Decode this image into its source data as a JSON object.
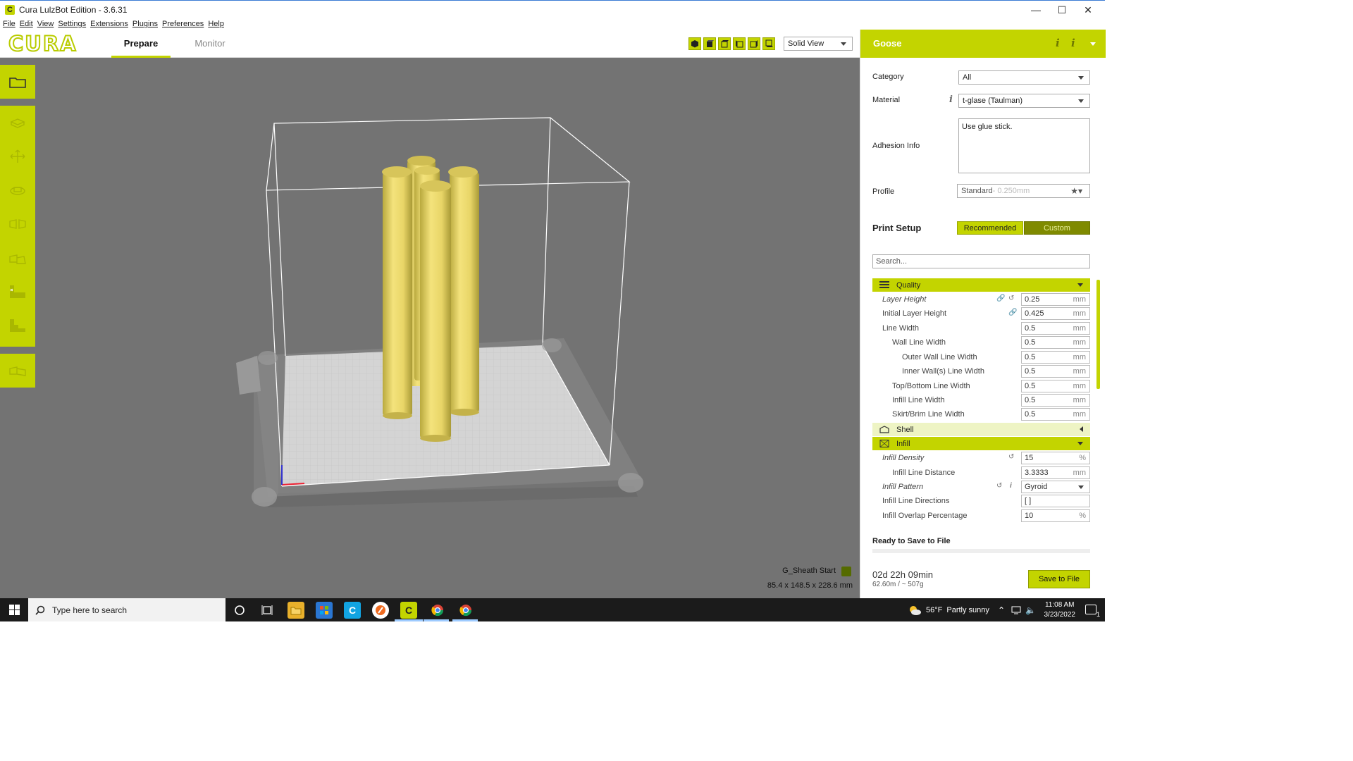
{
  "window": {
    "title": "Cura LulzBot Edition - 3.6.31"
  },
  "menu": [
    "File",
    "Edit",
    "View",
    "Settings",
    "Extensions",
    "Plugins",
    "Preferences",
    "Help"
  ],
  "header": {
    "logo": "CURA",
    "tabs": [
      {
        "label": "Prepare",
        "active": true
      },
      {
        "label": "Monitor",
        "active": false
      }
    ],
    "view_mode": "Solid View"
  },
  "viewport": {
    "object_name": "G_Sheath Start",
    "object_dims": "85.4 x 148.5 x 228.6 mm"
  },
  "panel": {
    "printer_name": "Goose",
    "category_label": "Category",
    "category_value": "All",
    "material_label": "Material",
    "material_value": "t-glase (Taulman)",
    "adhesion_label": "Adhesion Info",
    "adhesion_value": "Use glue stick.",
    "profile_label": "Profile",
    "profile_name": "Standard",
    "profile_detail": " - 0.250mm",
    "print_setup": "Print Setup",
    "mode_recommended": "Recommended",
    "mode_custom": "Custom",
    "search_placeholder": "Search...",
    "categories": {
      "quality": "Quality",
      "shell": "Shell",
      "infill": "Infill"
    },
    "quality_settings": [
      {
        "name": "Layer Height",
        "value": "0.25",
        "unit": "mm"
      },
      {
        "name": "Initial Layer Height",
        "value": "0.425",
        "unit": "mm"
      },
      {
        "name": "Line Width",
        "value": "0.5",
        "unit": "mm"
      },
      {
        "name": "Wall Line Width",
        "value": "0.5",
        "unit": "mm"
      },
      {
        "name": "Outer Wall Line Width",
        "value": "0.5",
        "unit": "mm"
      },
      {
        "name": "Inner Wall(s) Line Width",
        "value": "0.5",
        "unit": "mm"
      },
      {
        "name": "Top/Bottom Line Width",
        "value": "0.5",
        "unit": "mm"
      },
      {
        "name": "Infill Line Width",
        "value": "0.5",
        "unit": "mm"
      },
      {
        "name": "Skirt/Brim Line Width",
        "value": "0.5",
        "unit": "mm"
      }
    ],
    "infill_settings": [
      {
        "name": "Infill Density",
        "value": "15",
        "unit": "%"
      },
      {
        "name": "Infill Line Distance",
        "value": "3.3333",
        "unit": "mm"
      },
      {
        "name": "Infill Pattern",
        "value": "Gyroid",
        "unit": ""
      },
      {
        "name": "Infill Line Directions",
        "value": "[ ]",
        "unit": ""
      },
      {
        "name": "Infill Overlap Percentage",
        "value": "10",
        "unit": "%"
      }
    ],
    "ready_text": "Ready to Save to File",
    "print_time": "02d 22h 09min",
    "print_amount": "62.60m / ~ 507g",
    "save_button": "Save to File"
  },
  "taskbar": {
    "search_placeholder": "Type here to search",
    "weather_temp": "56°F",
    "weather_desc": "Partly sunny",
    "time": "11:08 AM",
    "date": "3/23/2022",
    "notification_count": "1"
  },
  "colors": {
    "accent": "#c3d400",
    "viewport_bg": "#737373",
    "model": "#f0e27a"
  }
}
